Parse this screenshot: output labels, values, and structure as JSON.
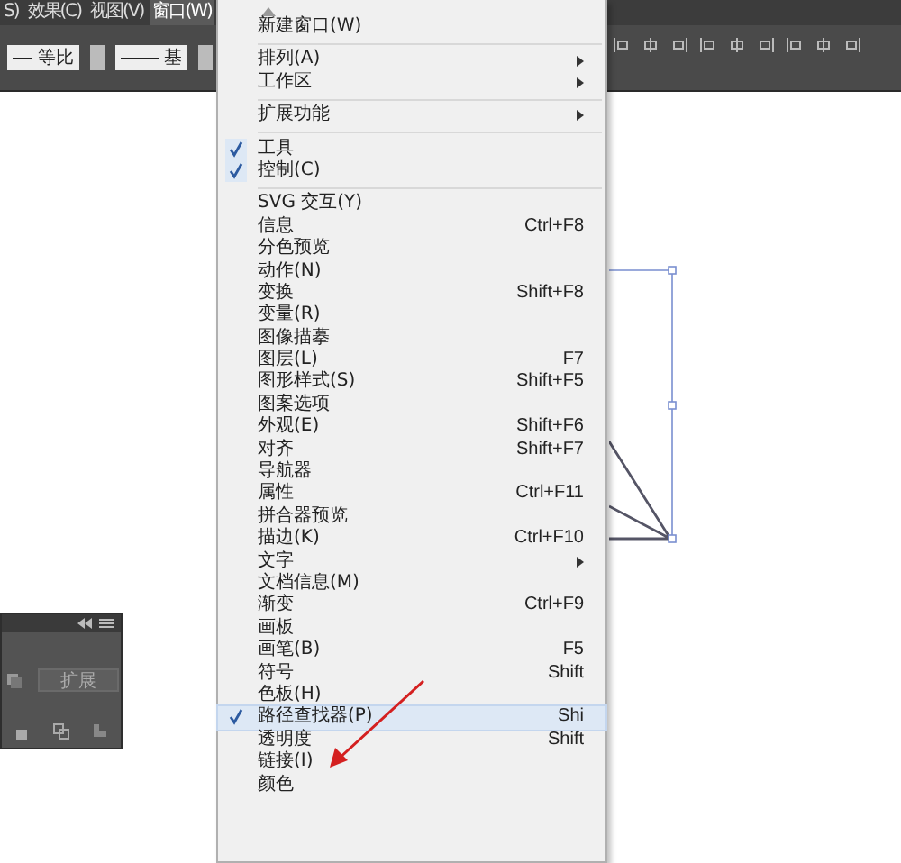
{
  "menu_bar": [
    {
      "label": "S)",
      "selected": false
    },
    {
      "label": "效果(C)",
      "selected": false
    },
    {
      "label": "视图(V)",
      "selected": false
    },
    {
      "label": "窗口(W)",
      "selected": true
    }
  ],
  "toolbar": {
    "stroke_profiles": [
      "等比",
      "基"
    ]
  },
  "panel": {
    "button": "扩展"
  },
  "menu": {
    "groups": [
      [
        {
          "label": "新建窗口(W)",
          "checked": false,
          "submenu": false,
          "selected": false
        }
      ],
      [
        {
          "label": "排列(A)",
          "checked": false,
          "submenu": true,
          "selected": false
        },
        {
          "label": "工作区",
          "checked": false,
          "submenu": true,
          "selected": false
        }
      ],
      [
        {
          "label": "扩展功能",
          "checked": false,
          "submenu": true,
          "selected": false
        }
      ],
      [
        {
          "label": "工具",
          "checked": true,
          "submenu": false,
          "selected": false
        },
        {
          "label": "控制(C)",
          "checked": true,
          "submenu": false,
          "selected": false
        }
      ],
      [
        {
          "label": "SVG 交互(Y)",
          "checked": false,
          "submenu": false,
          "selected": false
        },
        {
          "label": "信息",
          "shortcut": "Ctrl+F8",
          "checked": false,
          "submenu": false,
          "selected": false
        },
        {
          "label": "分色预览",
          "checked": false,
          "submenu": false,
          "selected": false
        },
        {
          "label": "动作(N)",
          "checked": false,
          "submenu": false,
          "selected": false
        },
        {
          "label": "变换",
          "shortcut": "Shift+F8",
          "checked": false,
          "submenu": false,
          "selected": false
        },
        {
          "label": "变量(R)",
          "checked": false,
          "submenu": false,
          "selected": false
        },
        {
          "label": "图像描摹",
          "checked": false,
          "submenu": false,
          "selected": false
        },
        {
          "label": "图层(L)",
          "shortcut": "F7",
          "checked": false,
          "submenu": false,
          "selected": false
        },
        {
          "label": "图形样式(S)",
          "shortcut": "Shift+F5",
          "checked": false,
          "submenu": false,
          "selected": false
        },
        {
          "label": "图案选项",
          "checked": false,
          "submenu": false,
          "selected": false
        },
        {
          "label": "外观(E)",
          "shortcut": "Shift+F6",
          "checked": false,
          "submenu": false,
          "selected": false
        },
        {
          "label": "对齐",
          "shortcut": "Shift+F7",
          "checked": false,
          "submenu": false,
          "selected": false
        },
        {
          "label": "导航器",
          "checked": false,
          "submenu": false,
          "selected": false
        },
        {
          "label": "属性",
          "shortcut": "Ctrl+F11",
          "checked": false,
          "submenu": false,
          "selected": false
        },
        {
          "label": "拼合器预览",
          "checked": false,
          "submenu": false,
          "selected": false
        },
        {
          "label": "描边(K)",
          "shortcut": "Ctrl+F10",
          "checked": false,
          "submenu": false,
          "selected": false
        },
        {
          "label": "文字",
          "checked": false,
          "submenu": true,
          "selected": false
        },
        {
          "label": "文档信息(M)",
          "checked": false,
          "submenu": false,
          "selected": false
        },
        {
          "label": "渐变",
          "shortcut": "Ctrl+F9",
          "checked": false,
          "submenu": false,
          "selected": false
        },
        {
          "label": "画板",
          "checked": false,
          "submenu": false,
          "selected": false
        },
        {
          "label": "画笔(B)",
          "shortcut": "F5",
          "checked": false,
          "submenu": false,
          "selected": false
        },
        {
          "label": "符号",
          "shortcut": "Shift",
          "checked": false,
          "submenu": false,
          "selected": false
        },
        {
          "label": "色板(H)",
          "checked": false,
          "submenu": false,
          "selected": false
        },
        {
          "label": "路径查找器(P)",
          "shortcut": "Shi",
          "checked": true,
          "submenu": false,
          "selected": true
        },
        {
          "label": "透明度",
          "shortcut": "Shift",
          "checked": false,
          "submenu": false,
          "selected": false
        },
        {
          "label": "链接(I)",
          "checked": false,
          "submenu": false,
          "selected": false
        },
        {
          "label": "颜色",
          "checked": false,
          "submenu": false,
          "selected": false
        }
      ]
    ]
  }
}
